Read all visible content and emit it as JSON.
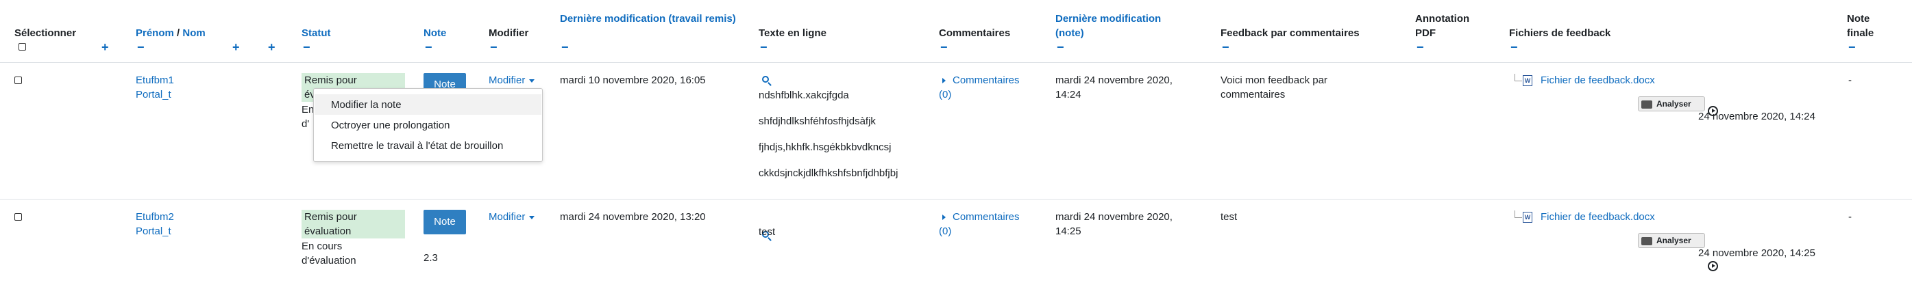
{
  "header": {
    "select": "Sélectionner",
    "firstname": "Prénom",
    "slash": " / ",
    "lastname": "Nom",
    "status": "Statut",
    "grade": "Note",
    "edit": "Modifier",
    "last_modified_submission": "Dernière modification (travail remis)",
    "online_text": "Texte en ligne",
    "comments": "Commentaires",
    "last_modified_grade": "Dernière modification (note)",
    "feedback_comments": "Feedback par commentaires",
    "pdf_annotation": "Annotation PDF",
    "feedback_files": "Fichiers de feedback",
    "final_grade": "Note finale",
    "minus": "−",
    "plus": "+"
  },
  "rows": [
    {
      "firstname": "Etufbm1",
      "lastname": "Portal_t",
      "status_primary": "Remis pour évaluation",
      "status_primary_visible": "Remis pour",
      "status_primary_visible2": "év",
      "status_secondary_visible": "En",
      "status_secondary_visible2": "d'",
      "grade_button": "Note",
      "edit_label": "Modifier",
      "submission_date": "mardi 10 novembre 2020, 16:05",
      "online_text": [
        "ndshfblhk.xakcjfgda",
        "shfdjhdlkshféhfosfhjdsàfjk",
        "fjhdjs,hkhfk.hsgékbkbvdkncsj",
        "ckkdsjnckjdlkfhkshfsbnfjdhbfjbj"
      ],
      "comments_label": "Commentaires",
      "comments_count": "(0)",
      "grade_modified": "mardi 24 novembre 2020, 14:24",
      "feedback_comment": "Voici mon feedback par commentaires",
      "feedback_file": "Fichier de feedback.docx",
      "analyser": "Analyser",
      "file_date": "24 novembre 2020, 14:24",
      "final_grade": "-"
    },
    {
      "firstname": "Etufbm2",
      "lastname": "Portal_t",
      "status_primary": "Remis pour évaluation",
      "status_secondary": "En cours d'évaluation",
      "grade_button": "Note",
      "grade_value": "2.3",
      "edit_label": "Modifier",
      "submission_date": "mardi 24 novembre 2020, 13:20",
      "online_text": [
        "test"
      ],
      "comments_label": "Commentaires",
      "comments_count": "(0)",
      "grade_modified": "mardi 24 novembre 2020, 14:25",
      "feedback_comment": "test",
      "feedback_file": "Fichier de feedback.docx",
      "analyser": "Analyser",
      "file_date": "24 novembre 2020, 14:25",
      "final_grade": "-"
    }
  ],
  "edit_menu": {
    "items": [
      "Modifier la note",
      "Octroyer une prolongation",
      "Remettre le travail à l'état de brouillon"
    ]
  },
  "icons": {
    "doc_icon_letter": "W"
  }
}
